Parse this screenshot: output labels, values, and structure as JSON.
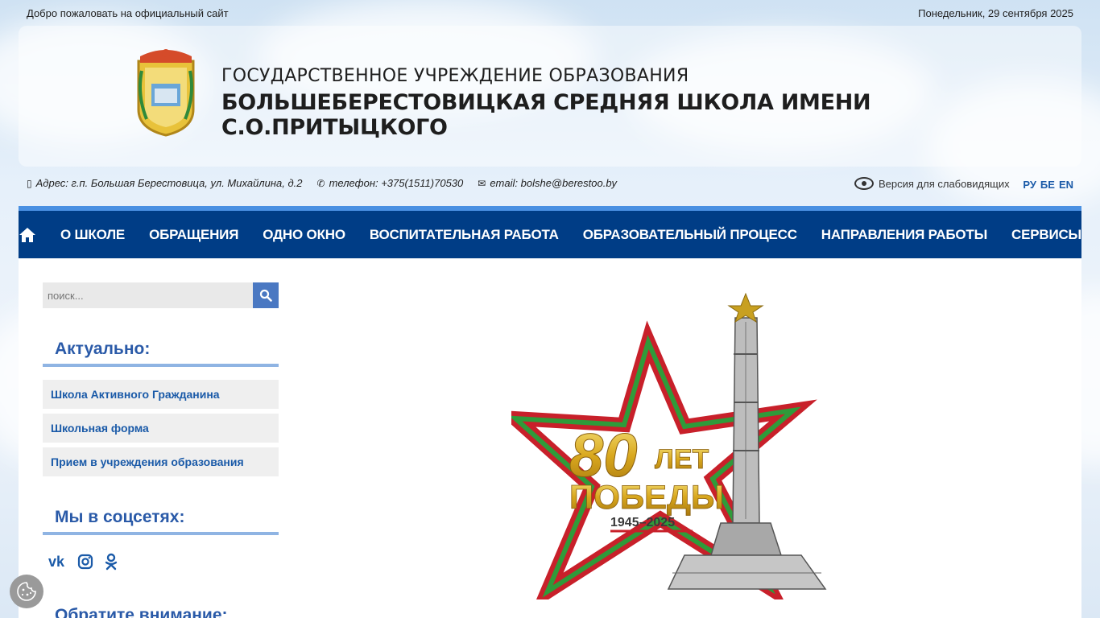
{
  "topbar": {
    "welcome": "Добро пожаловать на официальный сайт",
    "date": "Понедельник, 29 сентября 2025"
  },
  "header": {
    "title_line1": "ГОСУДАРСТВЕННОЕ УЧРЕЖДЕНИЕ ОБРАЗОВАНИЯ",
    "title_line2": "БОЛЬШЕБЕРЕСТОВИЦКАЯ СРЕДНЯЯ ШКОЛА ИМЕНИ С.О.ПРИТЫЦКОГО",
    "emblem_icon": "school-emblem-icon"
  },
  "contacts": {
    "address": "Адрес: г.п. Большая Берестовица, ул. Михайлина, д.2",
    "phone": "телефон: +375(1511)70530",
    "email": "email: bolshe@berestoo.by"
  },
  "accessibility": {
    "label": "Версия для слабовидящих",
    "icon": "eye-icon"
  },
  "languages": [
    "РУ",
    "БЕ",
    "EN"
  ],
  "nav": {
    "home_icon": "home-icon",
    "items": [
      "О ШКОЛЕ",
      "ОБРАЩЕНИЯ",
      "ОДНО ОКНО",
      "ВОСПИТАТЕЛЬНАЯ РАБОТА",
      "ОБРАЗОВАТЕЛЬНЫЙ ПРОЦЕСС",
      "НАПРАВЛЕНИЯ РАБОТЫ",
      "СЕРВИСЫ"
    ]
  },
  "sidebar": {
    "search_placeholder": "поиск...",
    "actual_title": "Актуально:",
    "actual_items": [
      "Школа Активного Гражданина",
      "Школьная форма",
      "Прием в учреждения образования"
    ],
    "social_title": "Мы в соцсетях:",
    "social_icons": [
      "vk-icon",
      "instagram-icon",
      "odnoklassniki-icon"
    ],
    "attention_title": "Обратите внимание:"
  },
  "banner": {
    "big_text": "80",
    "word1": "ЛЕТ",
    "word2": "ПОБЕДЫ",
    "years": "1945–2025"
  },
  "colors": {
    "nav_bg": "#003d86",
    "accent": "#2a5aa8",
    "star_red": "#c8202a",
    "star_green": "#2f9b3a",
    "gold": "#d9a81e"
  }
}
